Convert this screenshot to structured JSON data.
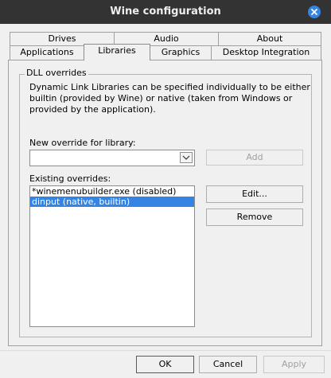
{
  "window": {
    "title": "Wine configuration",
    "accent": "#3584e4"
  },
  "tabs_row1": [
    {
      "label": "Drives"
    },
    {
      "label": "Audio"
    },
    {
      "label": "About"
    }
  ],
  "tabs_row2": [
    {
      "label": "Applications"
    },
    {
      "label": "Libraries",
      "selected": true
    },
    {
      "label": "Graphics"
    },
    {
      "label": "Desktop Integration"
    }
  ],
  "dll": {
    "group_title": "DLL overrides",
    "description_lines": [
      "Dynamic Link Libraries can be specified individually to be either",
      "builtin (provided by Wine) or native (taken from Windows or",
      "provided by the application)."
    ],
    "new_override_label": "New override for library:",
    "new_override_value": "",
    "add_label": "Add",
    "existing_label": "Existing overrides:",
    "overrides": [
      {
        "text": "*winemenubuilder.exe (disabled)",
        "selected": false
      },
      {
        "text": "dinput (native, builtin)",
        "selected": true
      }
    ],
    "edit_label": "Edit...",
    "remove_label": "Remove"
  },
  "footer": {
    "ok_label": "OK",
    "cancel_label": "Cancel",
    "apply_label": "Apply"
  },
  "icons": {
    "close": "close-icon",
    "dropdown": "chevron-down-icon"
  }
}
